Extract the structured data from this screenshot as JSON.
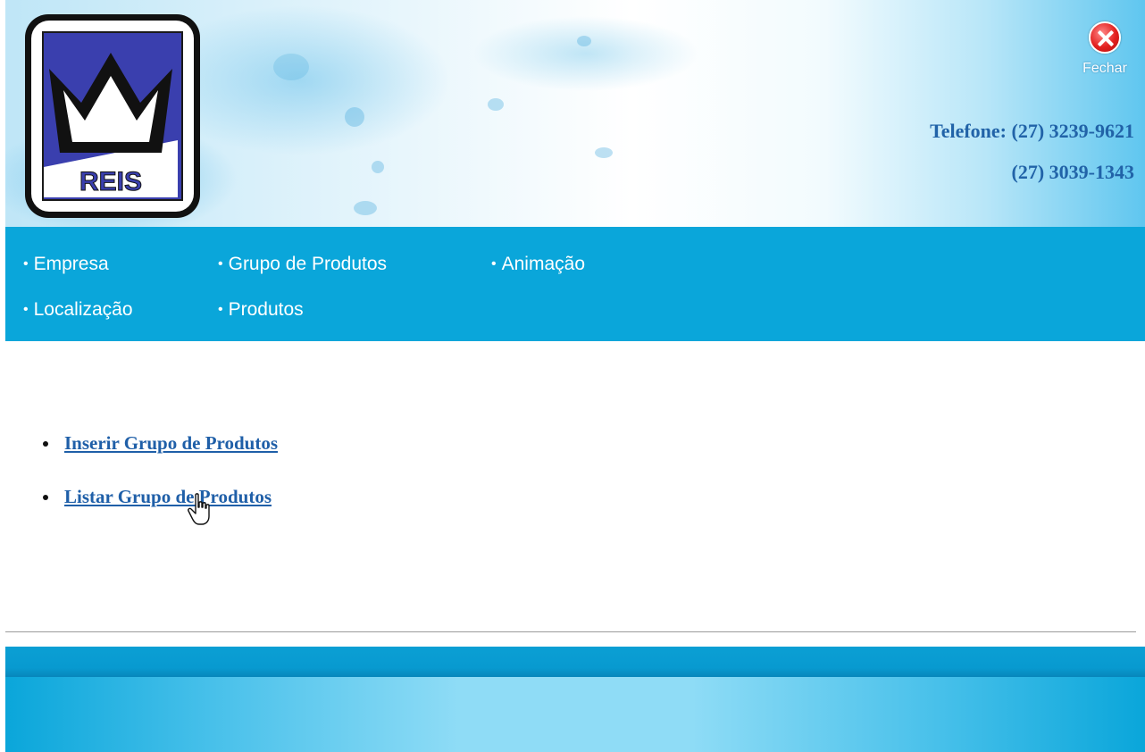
{
  "header": {
    "close_label": "Fechar",
    "phone_line1": "Telefone: (27) 3239-9621",
    "phone_line2": "(27) 3039-1343"
  },
  "nav": {
    "items": [
      {
        "label": "Empresa"
      },
      {
        "label": "Grupo de Produtos"
      },
      {
        "label": "Animação"
      },
      {
        "label": "Localização"
      },
      {
        "label": "Produtos"
      }
    ],
    "bullet": "•"
  },
  "content": {
    "links": [
      {
        "label": "Inserir Grupo de Produtos"
      },
      {
        "label": "Listar Grupo de Produtos"
      }
    ]
  },
  "colors": {
    "nav_bg": "#0aa6da",
    "link": "#1f5fa8",
    "phone": "#2163a8",
    "close": "#e3201f"
  },
  "icons": {
    "logo": "reis-crown-logo",
    "close": "close-icon",
    "cursor": "hand-pointer-cursor"
  }
}
